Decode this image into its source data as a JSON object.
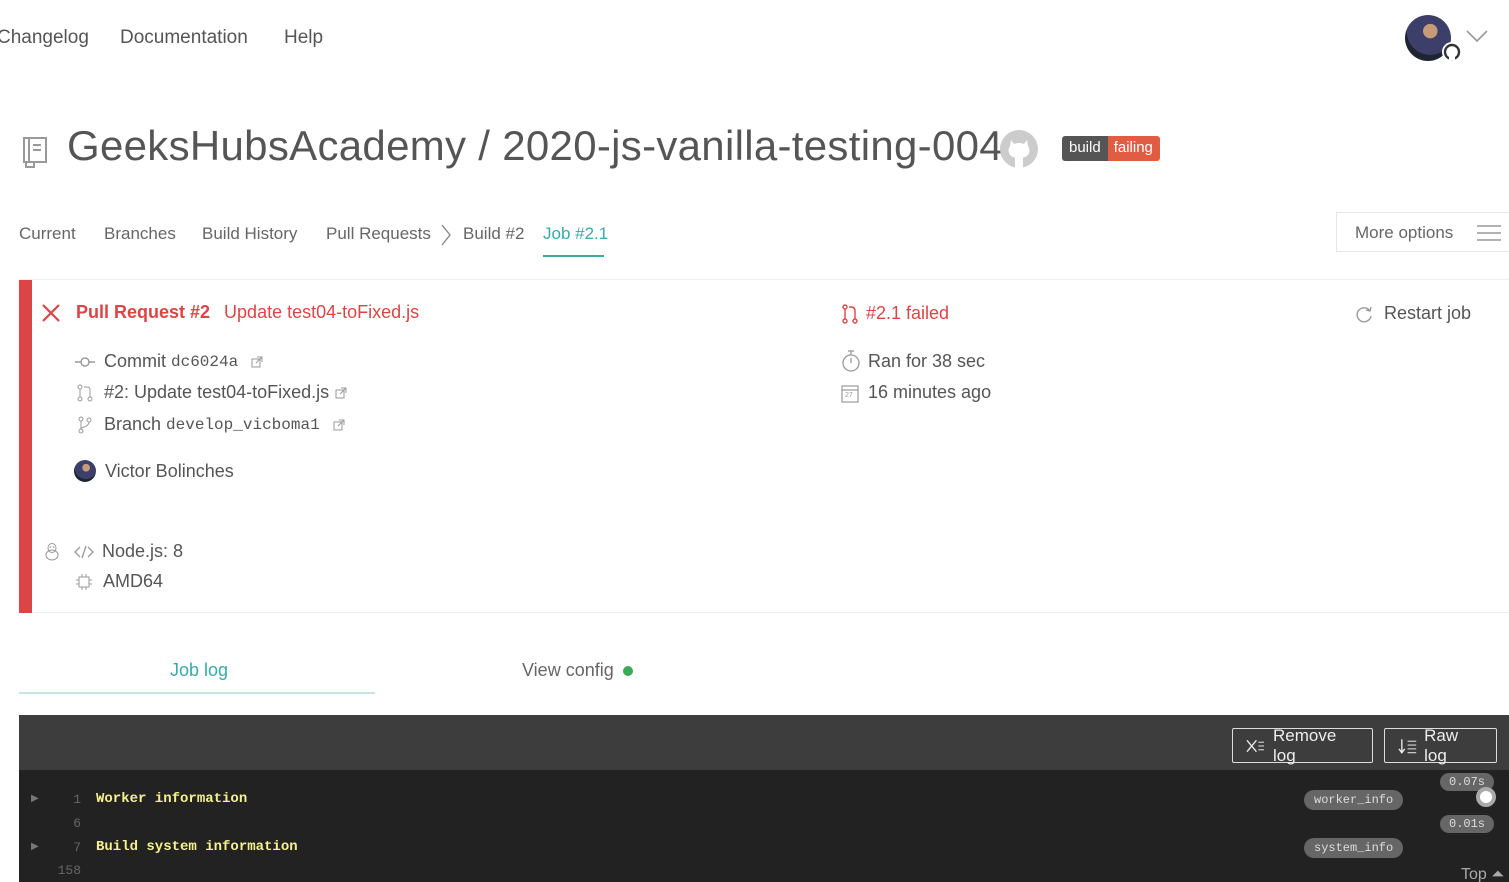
{
  "nav": {
    "changelog": "Changelog",
    "documentation": "Documentation",
    "help": "Help"
  },
  "repo": {
    "title": "GeeksHubsAcademy / 2020-js-vanilla-testing-004",
    "badge_left": "build",
    "badge_right": "failing"
  },
  "tabs": {
    "current": "Current",
    "branches": "Branches",
    "history": "Build History",
    "pull_requests": "Pull Requests",
    "build": "Build #2",
    "job": "Job #2.1",
    "more": "More options"
  },
  "job": {
    "pr_label": "Pull Request #2",
    "pr_title": "Update test04-toFixed.js",
    "commit_label": "Commit",
    "commit_sha": "dc6024a",
    "pr_ref": "#2: Update test04-toFixed.js",
    "branch_label": "Branch",
    "branch_name": "develop_vicboma1",
    "author": "Victor Bolinches",
    "language": "Node.js: 8",
    "arch": "AMD64",
    "status": "#2.1 failed",
    "duration": "Ran for 38 sec",
    "finished": "16 minutes ago",
    "restart": "Restart job",
    "calendar_day": "27"
  },
  "log_tabs": {
    "job_log": "Job log",
    "view_config": "View config"
  },
  "log": {
    "remove": "Remove log",
    "raw": "Raw log",
    "lines": [
      {
        "num": "1",
        "text": "Worker information",
        "fold": "worker_info",
        "time": "0.07s"
      },
      {
        "num": "6",
        "text": "",
        "fold": "",
        "time": ""
      },
      {
        "num": "7",
        "text": "Build system information",
        "fold": "system_info",
        "time": "0.01s"
      },
      {
        "num": "158",
        "text": "",
        "fold": "",
        "time": ""
      }
    ],
    "top": "Top"
  },
  "colors": {
    "failed": "#db4545",
    "accent": "#39aaa6",
    "passed": "#39aa56"
  }
}
